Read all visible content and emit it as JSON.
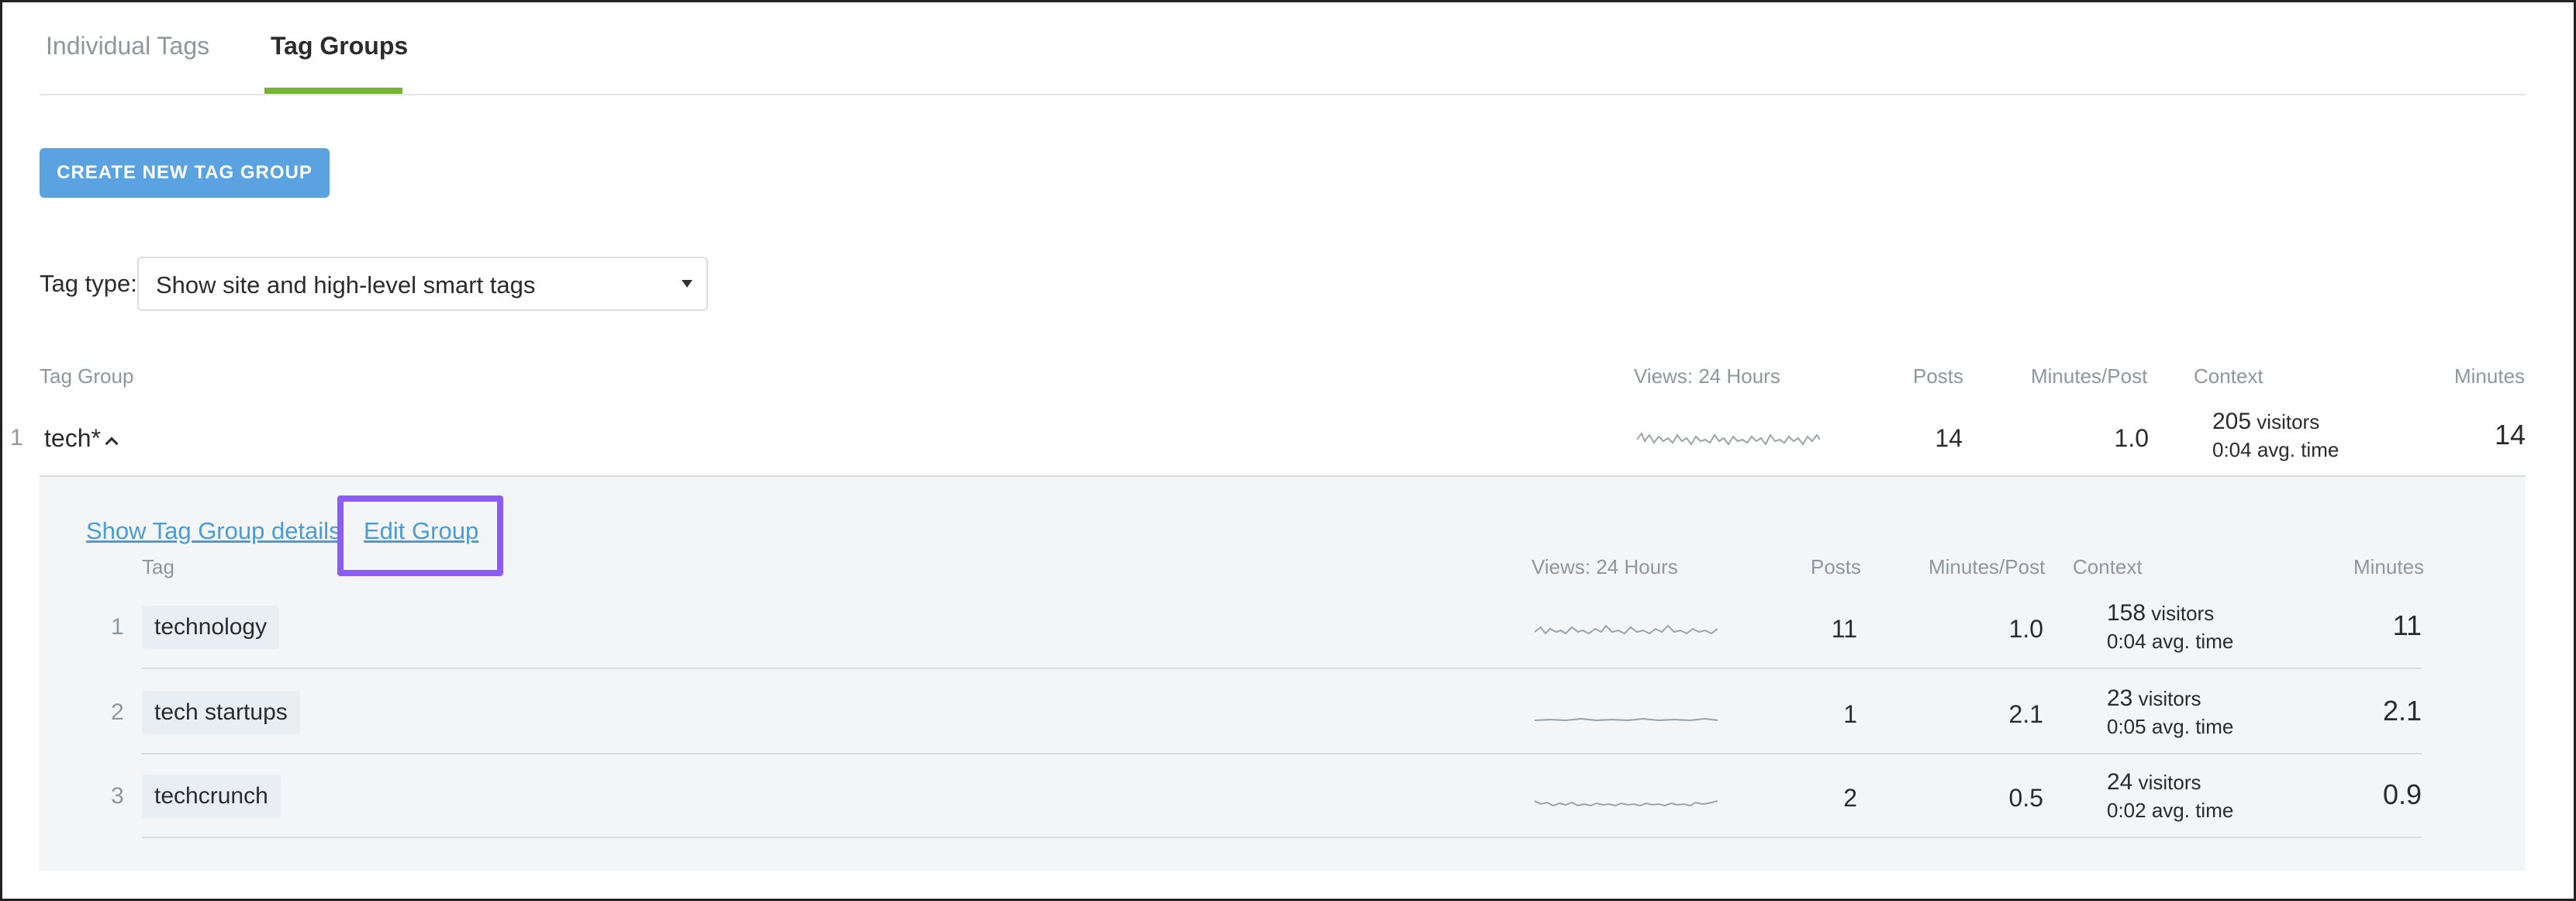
{
  "tabs": [
    {
      "label": "Individual Tags",
      "active": false
    },
    {
      "label": "Tag Groups",
      "active": true
    }
  ],
  "create_button": {
    "label": "CREATE NEW TAG GROUP"
  },
  "tag_type": {
    "label": "Tag type:",
    "selected": "Show site and high-level smart tags"
  },
  "group_headers": {
    "tag_group": "Tag Group",
    "views": "Views: 24 Hours",
    "posts": "Posts",
    "minutes_post": "Minutes/Post",
    "context": "Context",
    "minutes": "Minutes"
  },
  "group": {
    "rank": "1",
    "name": "tech*",
    "posts": "14",
    "minutes_post": "1.0",
    "visitors_count": "205",
    "visitors_word": "visitors",
    "avg_time": "0:04 avg. time",
    "minutes": "14"
  },
  "panel": {
    "show_details_link": "Show Tag Group details",
    "edit_group_link": "Edit Group",
    "headers": {
      "tag": "Tag",
      "views": "Views: 24 Hours",
      "posts": "Posts",
      "minutes_post": "Minutes/Post",
      "context": "Context",
      "minutes": "Minutes"
    },
    "rows": [
      {
        "rank": "1",
        "tag": "technology",
        "posts": "11",
        "minutes_post": "1.0",
        "visitors_count": "158",
        "visitors_word": "visitors",
        "avg_time": "0:04 avg. time",
        "minutes": "11"
      },
      {
        "rank": "2",
        "tag": "tech startups",
        "posts": "1",
        "minutes_post": "2.1",
        "visitors_count": "23",
        "visitors_word": "visitors",
        "avg_time": "0:05 avg. time",
        "minutes": "2.1"
      },
      {
        "rank": "3",
        "tag": "techcrunch",
        "posts": "2",
        "minutes_post": "0.5",
        "visitors_count": "24",
        "visitors_word": "visitors",
        "avg_time": "0:02 avg. time",
        "minutes": "0.9"
      }
    ]
  },
  "colors": {
    "tab_accent": "#79b335",
    "button": "#5aa2e0",
    "link": "#4a9bd6",
    "highlight": "#8b5cf6",
    "panel_bg": "#f3f5f7"
  }
}
